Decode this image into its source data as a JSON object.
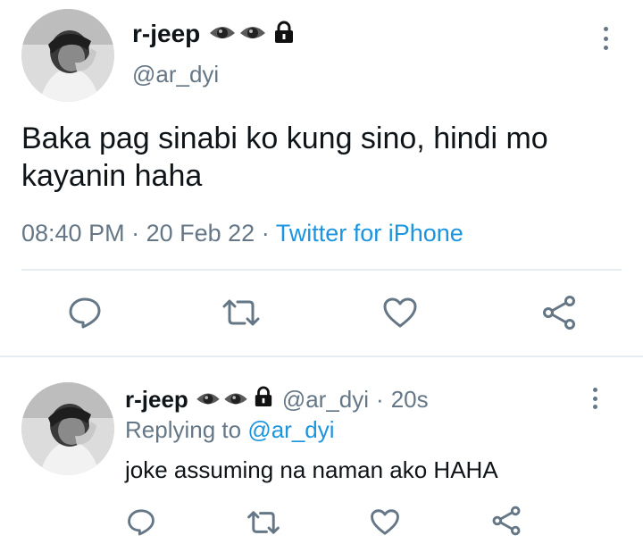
{
  "main_tweet": {
    "display_name": "r-jeep",
    "handle": "@ar_dyi",
    "text_line1": "Baka pag sinabi ko kung sino, hindi mo",
    "text_line2": "kayanin haha",
    "time": "08:40 PM",
    "sep1": "·",
    "date": "20 Feb 22",
    "sep2": "·",
    "source": "Twitter for iPhone"
  },
  "reply_tweet": {
    "display_name": "r-jeep",
    "handle": "@ar_dyi",
    "sep": "·",
    "age": "20s",
    "replying_prefix": "Replying to",
    "replying_handle": "@ar_dyi",
    "text": "joke assuming na naman ako HAHA"
  },
  "colors": {
    "link": "#1b95e0",
    "muted": "#657786",
    "divider": "#e6ecf0"
  },
  "icons": [
    "eye-icon",
    "lock-icon",
    "more-icon",
    "reply-icon",
    "retweet-icon",
    "like-icon",
    "share-icon"
  ]
}
